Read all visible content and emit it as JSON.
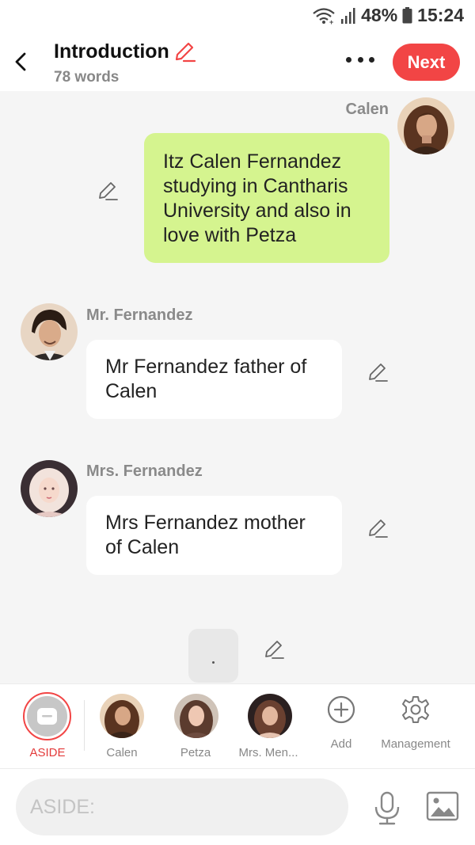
{
  "status": {
    "battery": "48%",
    "time": "15:24"
  },
  "header": {
    "title": "Introduction",
    "word_count": "78 words",
    "next_label": "Next"
  },
  "messages": [
    {
      "speaker": "Calen",
      "text": "Itz Calen Fernandez studying in Cantharis University and also in love with Petza"
    },
    {
      "speaker": "Mr. Fernandez",
      "text": "Mr Fernandez father of Calen"
    },
    {
      "speaker": "Mrs. Fernandez",
      "text": "Mrs Fernandez mother of Calen"
    }
  ],
  "typing_text": ".",
  "characters": [
    {
      "label": "ASIDE"
    },
    {
      "label": "Calen"
    },
    {
      "label": "Petza"
    },
    {
      "label": "Mrs. Men..."
    },
    {
      "label": "Add"
    },
    {
      "label": "Management"
    }
  ],
  "input": {
    "placeholder": "ASIDE:"
  },
  "colors": {
    "accent": "#f24545",
    "user_bubble": "#d5f48f",
    "bubble": "#ffffff",
    "background": "#f5f5f5"
  },
  "icons": [
    "wifi-icon",
    "signal-icon",
    "battery-icon",
    "back-arrow-icon",
    "pencil-icon",
    "more-icon",
    "message-icon",
    "add-icon",
    "gear-icon",
    "mic-icon",
    "image-icon"
  ]
}
